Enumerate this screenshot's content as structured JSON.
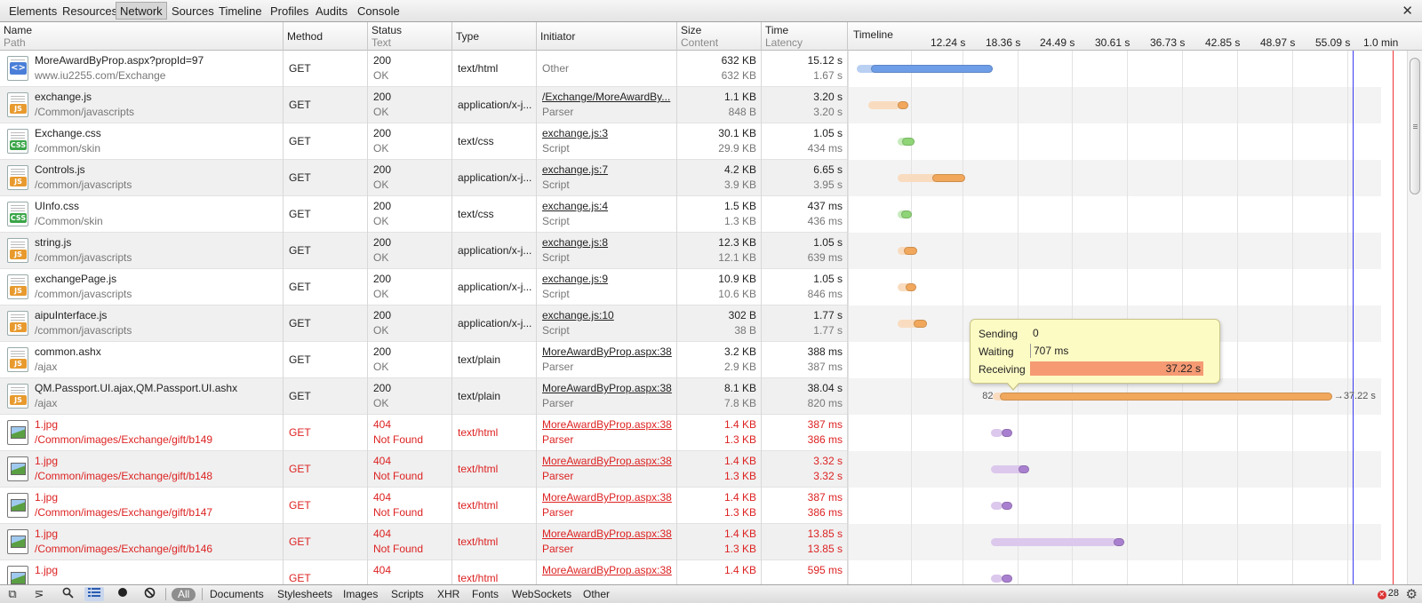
{
  "top_tabs": [
    {
      "label": "Elements"
    },
    {
      "label": "Resources"
    },
    {
      "label": "Network",
      "selected": true
    },
    {
      "label": "Sources"
    },
    {
      "label": "Timeline"
    },
    {
      "label": "Profiles"
    },
    {
      "label": "Audits"
    },
    {
      "label": "Console"
    }
  ],
  "header": {
    "name": "Name",
    "path": "Path",
    "method": "Method",
    "status": "Status",
    "text": "Text",
    "type": "Type",
    "initiator": "Initiator",
    "size": "Size",
    "content": "Content",
    "time": "Time",
    "latency": "Latency",
    "timeline": "Timeline",
    "ticks": [
      "12.24 s",
      "18.36 s",
      "24.49 s",
      "30.61 s",
      "36.73 s",
      "42.85 s",
      "48.97 s",
      "55.09 s",
      "1.0 min"
    ]
  },
  "rows": [
    {
      "icon": "html",
      "name": "MoreAwardByProp.aspx?propId=97",
      "path": "www.iu2255.com/Exchange",
      "method": "GET",
      "status": "200",
      "text": "OK",
      "type": "text/html",
      "initiator": "Other",
      "initiator_sub": "",
      "initiator_link": false,
      "size": "632 KB",
      "content": "632 KB",
      "time": "15.12 s",
      "latency": "1.67 s",
      "error": false
    },
    {
      "icon": "js",
      "name": "exchange.js",
      "path": "/Common/javascripts",
      "method": "GET",
      "status": "200",
      "text": "OK",
      "type": "application/x-j...",
      "initiator": "/Exchange/MoreAwardBy...",
      "initiator_sub": "Parser",
      "initiator_link": true,
      "size": "1.1 KB",
      "content": "848 B",
      "time": "3.20 s",
      "latency": "3.20 s",
      "error": false
    },
    {
      "icon": "css",
      "name": "Exchange.css",
      "path": "/common/skin",
      "method": "GET",
      "status": "200",
      "text": "OK",
      "type": "text/css",
      "initiator": "exchange.js:3",
      "initiator_sub": "Script",
      "initiator_link": true,
      "size": "30.1 KB",
      "content": "29.9 KB",
      "time": "1.05 s",
      "latency": "434 ms",
      "error": false
    },
    {
      "icon": "js",
      "name": "Controls.js",
      "path": "/common/javascripts",
      "method": "GET",
      "status": "200",
      "text": "OK",
      "type": "application/x-j...",
      "initiator": "exchange.js:7",
      "initiator_sub": "Script",
      "initiator_link": true,
      "size": "4.2 KB",
      "content": "3.9 KB",
      "time": "6.65 s",
      "latency": "3.95 s",
      "error": false
    },
    {
      "icon": "css",
      "name": "UInfo.css",
      "path": "/Common/skin",
      "method": "GET",
      "status": "200",
      "text": "OK",
      "type": "text/css",
      "initiator": "exchange.js:4",
      "initiator_sub": "Script",
      "initiator_link": true,
      "size": "1.5 KB",
      "content": "1.3 KB",
      "time": "437 ms",
      "latency": "436 ms",
      "error": false
    },
    {
      "icon": "js",
      "name": "string.js",
      "path": "/common/javascripts",
      "method": "GET",
      "status": "200",
      "text": "OK",
      "type": "application/x-j...",
      "initiator": "exchange.js:8",
      "initiator_sub": "Script",
      "initiator_link": true,
      "size": "12.3 KB",
      "content": "12.1 KB",
      "time": "1.05 s",
      "latency": "639 ms",
      "error": false
    },
    {
      "icon": "js",
      "name": "exchangePage.js",
      "path": "/common/javascripts",
      "method": "GET",
      "status": "200",
      "text": "OK",
      "type": "application/x-j...",
      "initiator": "exchange.js:9",
      "initiator_sub": "Script",
      "initiator_link": true,
      "size": "10.9 KB",
      "content": "10.6 KB",
      "time": "1.05 s",
      "latency": "846 ms",
      "error": false
    },
    {
      "icon": "js",
      "name": "aipuInterface.js",
      "path": "/common/javascripts",
      "method": "GET",
      "status": "200",
      "text": "OK",
      "type": "application/x-j...",
      "initiator": "exchange.js:10",
      "initiator_sub": "Script",
      "initiator_link": true,
      "size": "302 B",
      "content": "38 B",
      "time": "1.77 s",
      "latency": "1.77 s",
      "error": false
    },
    {
      "icon": "js",
      "name": "common.ashx",
      "path": "/ajax",
      "method": "GET",
      "status": "200",
      "text": "OK",
      "type": "text/plain",
      "initiator": "MoreAwardByProp.aspx:38",
      "initiator_sub": "Parser",
      "initiator_link": true,
      "size": "3.2 KB",
      "content": "2.9 KB",
      "time": "388 ms",
      "latency": "387 ms",
      "error": false
    },
    {
      "icon": "js",
      "name": "QM.Passport.UI.ajax,QM.Passport.UI.ashx",
      "path": "/ajax",
      "method": "GET",
      "status": "200",
      "text": "OK",
      "type": "text/plain",
      "initiator": "MoreAwardByProp.aspx:38",
      "initiator_sub": "Parser",
      "initiator_link": true,
      "size": "8.1 KB",
      "content": "7.8 KB",
      "time": "38.04 s",
      "latency": "820 ms",
      "error": false
    },
    {
      "icon": "img",
      "name": "1.jpg",
      "path": "/Common/images/Exchange/gift/b149",
      "method": "GET",
      "status": "404",
      "text": "Not Found",
      "type": "text/html",
      "initiator": "MoreAwardByProp.aspx:38",
      "initiator_sub": "Parser",
      "initiator_link": true,
      "size": "1.4 KB",
      "content": "1.3 KB",
      "time": "387 ms",
      "latency": "386 ms",
      "error": true
    },
    {
      "icon": "img",
      "name": "1.jpg",
      "path": "/Common/images/Exchange/gift/b148",
      "method": "GET",
      "status": "404",
      "text": "Not Found",
      "type": "text/html",
      "initiator": "MoreAwardByProp.aspx:38",
      "initiator_sub": "Parser",
      "initiator_link": true,
      "size": "1.4 KB",
      "content": "1.3 KB",
      "time": "3.32 s",
      "latency": "3.32 s",
      "error": true
    },
    {
      "icon": "img",
      "name": "1.jpg",
      "path": "/Common/images/Exchange/gift/b147",
      "method": "GET",
      "status": "404",
      "text": "Not Found",
      "type": "text/html",
      "initiator": "MoreAwardByProp.aspx:38",
      "initiator_sub": "Parser",
      "initiator_link": true,
      "size": "1.4 KB",
      "content": "1.3 KB",
      "time": "387 ms",
      "latency": "386 ms",
      "error": true
    },
    {
      "icon": "img",
      "name": "1.jpg",
      "path": "/Common/images/Exchange/gift/b146",
      "method": "GET",
      "status": "404",
      "text": "Not Found",
      "type": "text/html",
      "initiator": "MoreAwardByProp.aspx:38",
      "initiator_sub": "Parser",
      "initiator_link": true,
      "size": "1.4 KB",
      "content": "1.3 KB",
      "time": "13.85 s",
      "latency": "13.85 s",
      "error": true
    },
    {
      "icon": "img",
      "name": "1.jpg",
      "path": "",
      "method": "GET",
      "status": "404",
      "text": "",
      "type": "text/html",
      "initiator": "MoreAwardByProp.aspx:38",
      "initiator_sub": "",
      "initiator_link": true,
      "size": "1.4 KB",
      "content": "",
      "time": "595 ms",
      "latency": "",
      "error": true
    }
  ],
  "timeline_axis": {
    "start_s": 0,
    "end_s": 61.2
  },
  "timeline_bars": [
    {
      "row": 0,
      "start_s": 0.5,
      "latency_end_s": 2.1,
      "end_s": 15.6,
      "color": "blue"
    },
    {
      "row": 1,
      "start_s": 1.8,
      "latency_end_s": 5.0,
      "end_s": 5.3,
      "color": "orange"
    },
    {
      "row": 2,
      "start_s": 5.0,
      "latency_end_s": 5.5,
      "end_s": 6.9,
      "color": "green"
    },
    {
      "row": 3,
      "start_s": 5.0,
      "latency_end_s": 8.9,
      "end_s": 12.5,
      "color": "orange"
    },
    {
      "row": 4,
      "start_s": 5.0,
      "latency_end_s": 5.4,
      "end_s": 6.4,
      "color": "green"
    },
    {
      "row": 5,
      "start_s": 5.0,
      "latency_end_s": 5.7,
      "end_s": 7.2,
      "color": "orange"
    },
    {
      "row": 6,
      "start_s": 5.0,
      "latency_end_s": 5.9,
      "end_s": 7.0,
      "color": "orange"
    },
    {
      "row": 7,
      "start_s": 5.0,
      "latency_end_s": 6.8,
      "end_s": 8.3,
      "color": "orange"
    },
    {
      "row": 9,
      "start_s": 15.6,
      "latency_end_s": 16.4,
      "end_s": 53.2,
      "color": "orange",
      "left_label": "82",
      "right_label": "37.22 s"
    },
    {
      "row": 10,
      "start_s": 15.4,
      "latency_end_s": 16.6,
      "end_s": 16.7,
      "color": "purple"
    },
    {
      "row": 11,
      "start_s": 15.4,
      "latency_end_s": 18.4,
      "end_s": 19.1,
      "color": "purple"
    },
    {
      "row": 12,
      "start_s": 15.4,
      "latency_end_s": 16.6,
      "end_s": 16.7,
      "color": "purple"
    },
    {
      "row": 13,
      "start_s": 15.4,
      "latency_end_s": 29.0,
      "end_s": 29.4,
      "color": "purple"
    },
    {
      "row": 14,
      "start_s": 15.4,
      "latency_end_s": 16.6,
      "end_s": 16.7,
      "color": "purple"
    }
  ],
  "markers": {
    "blue_s": 55.5,
    "red_s": 59.9
  },
  "tooltip": {
    "sending_label": "Sending",
    "sending_value": "0",
    "waiting_label": "Waiting",
    "waiting_value": "707 ms",
    "receiving_label": "Receiving",
    "receiving_value": "37.22 s"
  },
  "bottom": {
    "filters": [
      "All",
      "Documents",
      "Stylesheets",
      "Images",
      "Scripts",
      "XHR",
      "Fonts",
      "WebSockets",
      "Other"
    ],
    "error_count": "28"
  },
  "colors": {
    "blue": [
      "#b9d0f3",
      "#6f9ee8"
    ],
    "orange": [
      "#f9dcbf",
      "#f1a85c"
    ],
    "green": [
      "#c8ebbd",
      "#8fd476"
    ],
    "purple": [
      "#dcc8ec",
      "#a980cf"
    ],
    "error_text": "#dd2222",
    "marker_blue": "#3b3bf0",
    "marker_red": "#ee3333",
    "tooltip_bg": "#fdfbc4",
    "receiving_bar": "#f59a73"
  }
}
